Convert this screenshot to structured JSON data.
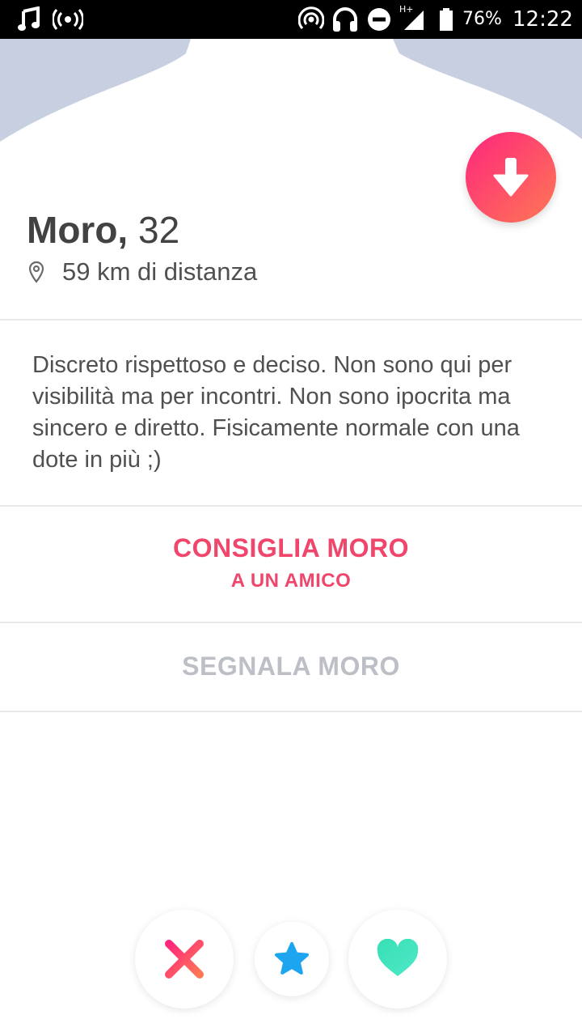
{
  "status_bar": {
    "battery_percent": "76%",
    "time": "12:22",
    "network": "H+",
    "icons": [
      "music-note-icon",
      "broadcast-icon",
      "hotspot-icon",
      "headphones-icon",
      "do-not-disturb-icon",
      "signal-icon",
      "battery-icon"
    ]
  },
  "profile": {
    "name": "Moro",
    "separator": ", ",
    "age": "32",
    "distance": "59 km di distanza",
    "bio": "Discreto rispettoso e deciso. Non sono qui per visibilità ma per incontri. Non sono ipocrita ma sincero e diretto. Fisicamente normale con una dote in più ;)"
  },
  "actions": {
    "share_line1": "CONSIGLIA MORO",
    "share_line2": "A UN AMICO",
    "report": "SEGNALA MORO"
  },
  "bottom_buttons": {
    "nope_icon": "close-icon",
    "super_like_icon": "star-icon",
    "like_icon": "heart-icon"
  },
  "colors": {
    "brand_gradient_start": "#fd267d",
    "brand_gradient_end": "#ff7854",
    "accent_text": "#f0466b",
    "muted_text": "#bcbfc6",
    "star_blue": "#1ea5f0",
    "heart_green": "#37e0b4",
    "photo_bg": "#c7cfe0"
  }
}
